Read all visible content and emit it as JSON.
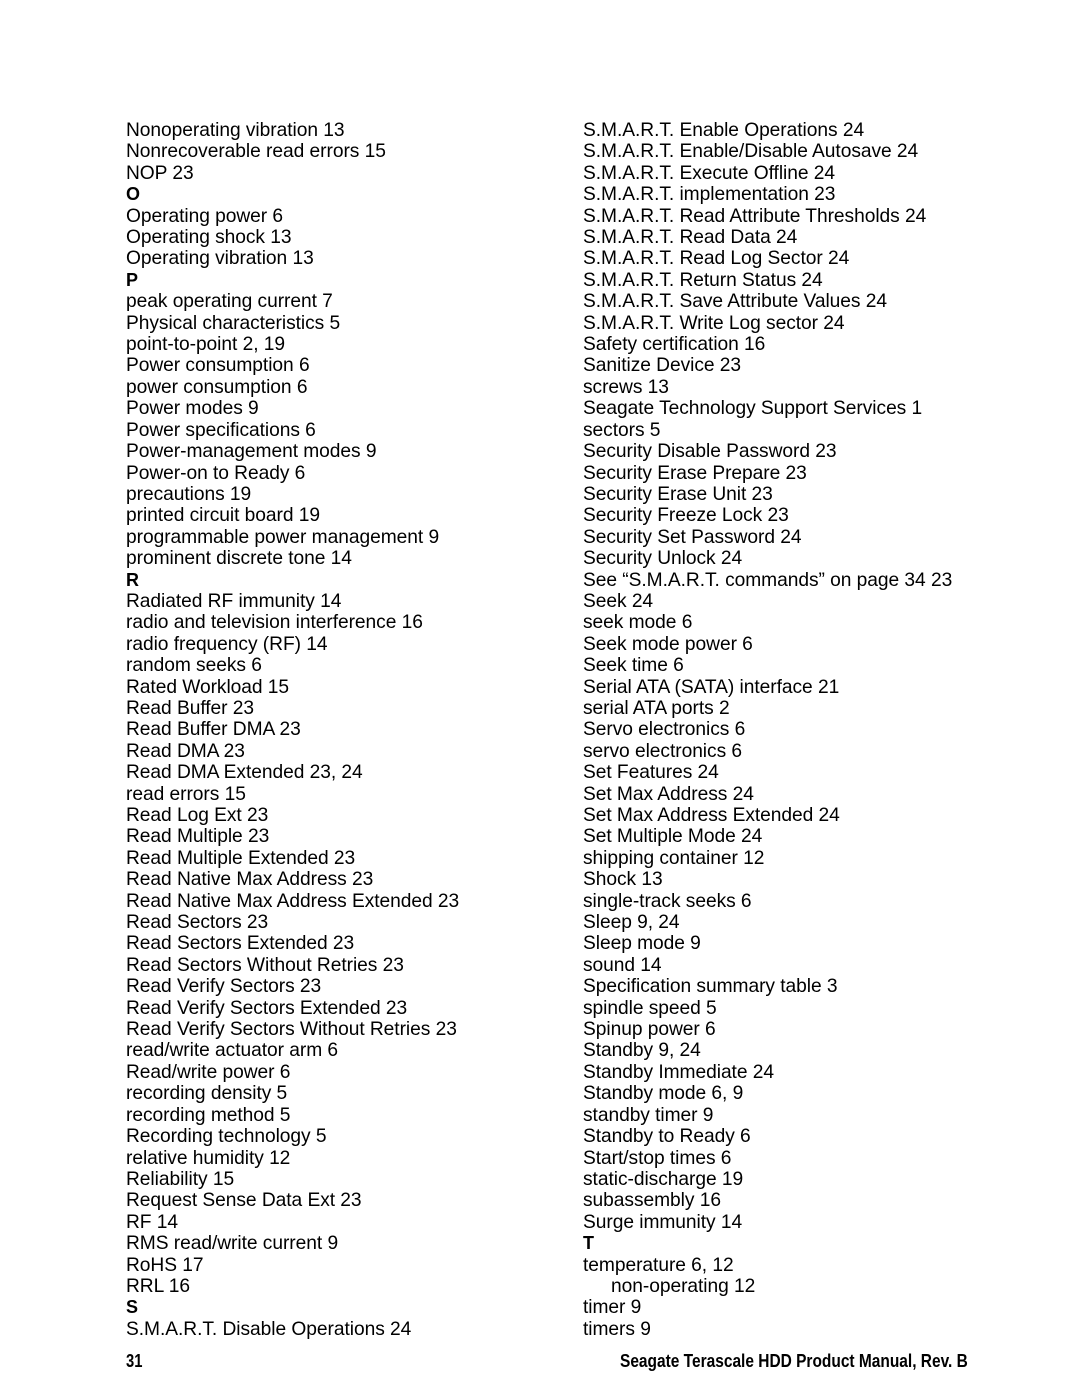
{
  "document": {
    "kind": "index",
    "page_number": "31",
    "footer_title": "Seagate Terascale HDD Product Manual, Rev. B",
    "text_color": "#000000",
    "background_color": "#ffffff"
  },
  "columns": [
    {
      "name": "left-column",
      "entries": [
        {
          "text": "Nonoperating vibration 13",
          "style": "entry"
        },
        {
          "text": "Nonrecoverable read errors 15",
          "style": "entry"
        },
        {
          "text": "NOP 23",
          "style": "entry"
        },
        {
          "text": "O",
          "style": "letter"
        },
        {
          "text": "Operating power 6",
          "style": "entry"
        },
        {
          "text": "Operating shock 13",
          "style": "entry"
        },
        {
          "text": "Operating vibration 13",
          "style": "entry"
        },
        {
          "text": "P",
          "style": "letter"
        },
        {
          "text": "peak operating current 7",
          "style": "entry"
        },
        {
          "text": "Physical characteristics 5",
          "style": "entry"
        },
        {
          "text": "point-to-point 2, 19",
          "style": "entry"
        },
        {
          "text": "Power consumption 6",
          "style": "entry"
        },
        {
          "text": "power consumption 6",
          "style": "entry"
        },
        {
          "text": "Power modes 9",
          "style": "entry"
        },
        {
          "text": "Power specifications 6",
          "style": "entry"
        },
        {
          "text": "Power-management modes 9",
          "style": "entry"
        },
        {
          "text": "Power-on to Ready 6",
          "style": "entry"
        },
        {
          "text": "precautions 19",
          "style": "entry"
        },
        {
          "text": "printed circuit board 19",
          "style": "entry"
        },
        {
          "text": "programmable power management 9",
          "style": "entry"
        },
        {
          "text": "prominent discrete tone 14",
          "style": "entry"
        },
        {
          "text": "R",
          "style": "letter"
        },
        {
          "text": "Radiated RF immunity 14",
          "style": "entry"
        },
        {
          "text": "radio and television interference 16",
          "style": "entry"
        },
        {
          "text": "radio frequency (RF) 14",
          "style": "entry"
        },
        {
          "text": "random seeks 6",
          "style": "entry"
        },
        {
          "text": "Rated Workload 15",
          "style": "entry"
        },
        {
          "text": "Read Buffer 23",
          "style": "entry"
        },
        {
          "text": "Read Buffer DMA 23",
          "style": "entry"
        },
        {
          "text": "Read DMA 23",
          "style": "entry"
        },
        {
          "text": "Read DMA Extended 23, 24",
          "style": "entry"
        },
        {
          "text": "read errors 15",
          "style": "entry"
        },
        {
          "text": "Read Log Ext 23",
          "style": "entry"
        },
        {
          "text": "Read Multiple 23",
          "style": "entry"
        },
        {
          "text": "Read Multiple Extended 23",
          "style": "entry"
        },
        {
          "text": "Read Native Max Address 23",
          "style": "entry"
        },
        {
          "text": "Read Native Max Address Extended 23",
          "style": "entry"
        },
        {
          "text": "Read Sectors 23",
          "style": "entry"
        },
        {
          "text": "Read Sectors Extended 23",
          "style": "entry"
        },
        {
          "text": "Read Sectors Without Retries 23",
          "style": "entry"
        },
        {
          "text": "Read Verify Sectors 23",
          "style": "entry"
        },
        {
          "text": "Read Verify Sectors Extended 23",
          "style": "entry"
        },
        {
          "text": "Read Verify Sectors Without Retries 23",
          "style": "entry"
        },
        {
          "text": "read/write actuator arm 6",
          "style": "entry"
        },
        {
          "text": "Read/write power 6",
          "style": "entry"
        },
        {
          "text": "recording density 5",
          "style": "entry"
        },
        {
          "text": "recording method 5",
          "style": "entry"
        },
        {
          "text": "Recording technology 5",
          "style": "entry"
        },
        {
          "text": "relative humidity 12",
          "style": "entry"
        },
        {
          "text": "Reliability 15",
          "style": "entry"
        },
        {
          "text": "Request Sense Data Ext 23",
          "style": "entry"
        },
        {
          "text": "RF 14",
          "style": "entry"
        },
        {
          "text": "RMS read/write current 9",
          "style": "entry"
        },
        {
          "text": "RoHS 17",
          "style": "entry"
        },
        {
          "text": "RRL 16",
          "style": "entry"
        },
        {
          "text": "S",
          "style": "letter"
        },
        {
          "text": "S.M.A.R.T. Disable Operations 24",
          "style": "entry"
        }
      ]
    },
    {
      "name": "right-column",
      "entries": [
        {
          "text": "S.M.A.R.T. Enable Operations 24",
          "style": "entry"
        },
        {
          "text": "S.M.A.R.T. Enable/Disable Autosave 24",
          "style": "entry"
        },
        {
          "text": "S.M.A.R.T. Execute Offline 24",
          "style": "entry"
        },
        {
          "text": "S.M.A.R.T. implementation 23",
          "style": "entry"
        },
        {
          "text": "S.M.A.R.T. Read Attribute Thresholds 24",
          "style": "entry"
        },
        {
          "text": "S.M.A.R.T. Read Data 24",
          "style": "entry"
        },
        {
          "text": "S.M.A.R.T. Read Log Sector 24",
          "style": "entry"
        },
        {
          "text": "S.M.A.R.T. Return Status 24",
          "style": "entry"
        },
        {
          "text": "S.M.A.R.T. Save Attribute Values 24",
          "style": "entry"
        },
        {
          "text": "S.M.A.R.T. Write Log sector 24",
          "style": "entry"
        },
        {
          "text": "Safety certification 16",
          "style": "entry"
        },
        {
          "text": "Sanitize Device 23",
          "style": "entry"
        },
        {
          "text": "screws 13",
          "style": "entry"
        },
        {
          "text": "Seagate Technology Support Services 1",
          "style": "entry"
        },
        {
          "text": "sectors 5",
          "style": "entry"
        },
        {
          "text": "Security Disable Password 23",
          "style": "entry"
        },
        {
          "text": "Security Erase Prepare 23",
          "style": "entry"
        },
        {
          "text": "Security Erase Unit 23",
          "style": "entry"
        },
        {
          "text": "Security Freeze Lock 23",
          "style": "entry"
        },
        {
          "text": "Security Set Password 24",
          "style": "entry"
        },
        {
          "text": "Security Unlock 24",
          "style": "entry"
        },
        {
          "text": "See “S.M.A.R.T. commands” on page 34 23",
          "style": "entry"
        },
        {
          "text": "Seek 24",
          "style": "entry"
        },
        {
          "text": "seek mode 6",
          "style": "entry"
        },
        {
          "text": "Seek mode power 6",
          "style": "entry"
        },
        {
          "text": "Seek time 6",
          "style": "entry"
        },
        {
          "text": "Serial ATA (SATA) interface 21",
          "style": "entry"
        },
        {
          "text": "serial ATA ports 2",
          "style": "entry"
        },
        {
          "text": "Servo electronics 6",
          "style": "entry"
        },
        {
          "text": "servo electronics 6",
          "style": "entry"
        },
        {
          "text": "Set Features 24",
          "style": "entry"
        },
        {
          "text": "Set Max Address 24",
          "style": "entry"
        },
        {
          "text": "Set Max Address Extended 24",
          "style": "entry"
        },
        {
          "text": "Set Multiple Mode 24",
          "style": "entry"
        },
        {
          "text": "shipping container 12",
          "style": "entry"
        },
        {
          "text": "Shock 13",
          "style": "entry"
        },
        {
          "text": "single-track seeks 6",
          "style": "entry"
        },
        {
          "text": "Sleep 9, 24",
          "style": "entry"
        },
        {
          "text": "Sleep mode 9",
          "style": "entry"
        },
        {
          "text": "sound 14",
          "style": "entry"
        },
        {
          "text": "Specification summary table 3",
          "style": "entry"
        },
        {
          "text": "spindle speed 5",
          "style": "entry"
        },
        {
          "text": "Spinup power 6",
          "style": "entry"
        },
        {
          "text": "Standby 9, 24",
          "style": "entry"
        },
        {
          "text": "Standby Immediate 24",
          "style": "entry"
        },
        {
          "text": "Standby mode 6, 9",
          "style": "entry"
        },
        {
          "text": "standby timer 9",
          "style": "entry"
        },
        {
          "text": "Standby to Ready 6",
          "style": "entry"
        },
        {
          "text": "Start/stop times 6",
          "style": "entry"
        },
        {
          "text": "static-discharge 19",
          "style": "entry"
        },
        {
          "text": "subassembly 16",
          "style": "entry"
        },
        {
          "text": "Surge immunity 14",
          "style": "entry"
        },
        {
          "text": "T",
          "style": "letter"
        },
        {
          "text": "temperature 6, 12",
          "style": "entry"
        },
        {
          "text": "non-operating 12",
          "style": "sub"
        },
        {
          "text": "timer 9",
          "style": "entry"
        },
        {
          "text": "timers 9",
          "style": "entry"
        }
      ]
    }
  ]
}
